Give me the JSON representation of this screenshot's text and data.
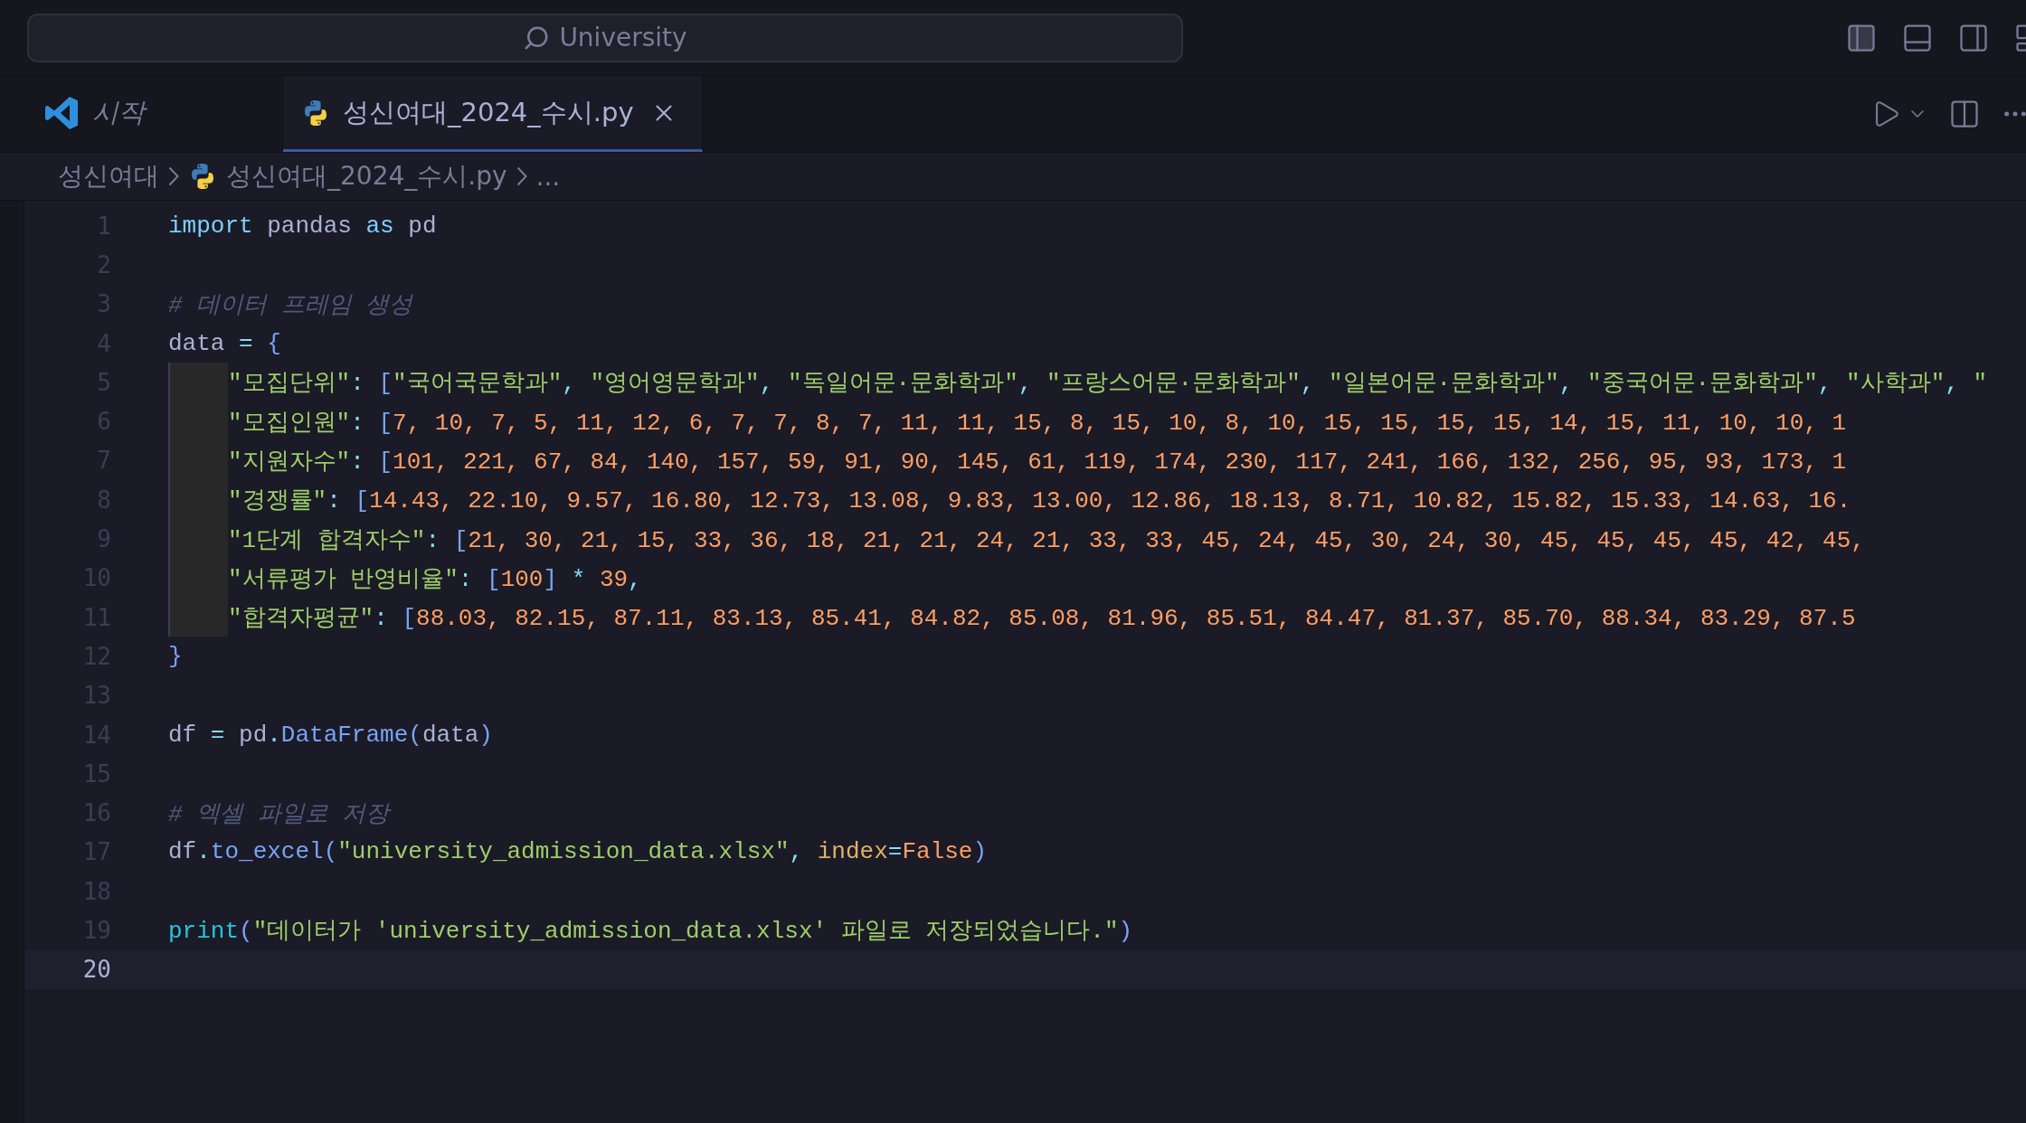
{
  "title_bar": {
    "search": {
      "value": "University"
    }
  },
  "tabs": [
    {
      "label": "시작",
      "kind": "welcome",
      "selected": false,
      "preview": true,
      "closable": false
    },
    {
      "label": "성신여대_2024_수시.py",
      "kind": "python",
      "selected": true,
      "preview": false,
      "closable": true
    }
  ],
  "breadcrumb": [
    {
      "label": "성신여대",
      "kind": "folder"
    },
    {
      "label": "성신여대_2024_수시.py",
      "kind": "python"
    },
    {
      "label": "...",
      "kind": "more"
    }
  ],
  "editor": {
    "lines": [
      {
        "number": "1",
        "active": false,
        "indented": false,
        "tokens": [
          {
            "kind": "keyword",
            "text": "import"
          },
          {
            "kind": "name",
            "text": " pandas "
          },
          {
            "kind": "keyword",
            "text": "as"
          },
          {
            "kind": "name",
            "text": " pd"
          }
        ]
      },
      {
        "number": "2",
        "active": false,
        "indented": false
      },
      {
        "number": "3",
        "active": false,
        "indented": false,
        "tokens": [
          {
            "kind": "comment",
            "text": "# 데이터 프레임 생성"
          }
        ]
      },
      {
        "number": "4",
        "active": false,
        "indented": false,
        "tokens": [
          {
            "kind": "name",
            "text": "data "
          },
          {
            "kind": "operator",
            "text": "="
          },
          {
            "kind": "bracket",
            "text": " {"
          }
        ]
      },
      {
        "number": "5",
        "active": false,
        "indented": true,
        "tokens": [
          {
            "kind": "string",
            "text": "\"모집단위\""
          },
          {
            "kind": "operator",
            "text": ": "
          },
          {
            "kind": "bracket",
            "text": "["
          },
          {
            "kind": "string",
            "text": "\"국어국문학과\""
          },
          {
            "kind": "operator",
            "text": ", "
          },
          {
            "kind": "string",
            "text": "\"영어영문학과\""
          },
          {
            "kind": "operator",
            "text": ", "
          },
          {
            "kind": "string",
            "text": "\"독일어문·문화학과\""
          },
          {
            "kind": "operator",
            "text": ", "
          },
          {
            "kind": "string",
            "text": "\"프랑스어문·문화학과\""
          },
          {
            "kind": "operator",
            "text": ", "
          },
          {
            "kind": "string",
            "text": "\"일본어문·문화학과\""
          },
          {
            "kind": "operator",
            "text": ", "
          },
          {
            "kind": "string",
            "text": "\"중국어문·문화학과\""
          },
          {
            "kind": "operator",
            "text": ", "
          },
          {
            "kind": "string",
            "text": "\"사학과\""
          },
          {
            "kind": "operator",
            "text": ", "
          },
          {
            "kind": "string",
            "text": "\""
          }
        ]
      },
      {
        "number": "6",
        "active": false,
        "indented": true,
        "tokens": [
          {
            "kind": "string",
            "text": "\"모집인원\""
          },
          {
            "kind": "operator",
            "text": ": "
          },
          {
            "kind": "bracket",
            "text": "["
          },
          {
            "kind": "number",
            "text": "7, 10, 7, 5, 11, 12, 6, 7, 7, 8, 7, 11, 11, 15, 8, 15, 10, 8, 10, 15, 15, 15, 15, 14, 15, 11, 10, 10, 1"
          }
        ]
      },
      {
        "number": "7",
        "active": false,
        "indented": true,
        "tokens": [
          {
            "kind": "string",
            "text": "\"지원자수\""
          },
          {
            "kind": "operator",
            "text": ": "
          },
          {
            "kind": "bracket",
            "text": "["
          },
          {
            "kind": "number",
            "text": "101, 221, 67, 84, 140, 157, 59, 91, 90, 145, 61, 119, 174, 230, 117, 241, 166, 132, 256, 95, 93, 173, 1"
          }
        ]
      },
      {
        "number": "8",
        "active": false,
        "indented": true,
        "tokens": [
          {
            "kind": "string",
            "text": "\"경쟁률\""
          },
          {
            "kind": "operator",
            "text": ": "
          },
          {
            "kind": "bracket",
            "text": "["
          },
          {
            "kind": "number",
            "text": "14.43, 22.10, 9.57, 16.80, 12.73, 13.08, 9.83, 13.00, 12.86, 18.13, 8.71, 10.82, 15.82, 15.33, 14.63, 16."
          }
        ]
      },
      {
        "number": "9",
        "active": false,
        "indented": true,
        "tokens": [
          {
            "kind": "string",
            "text": "\"1단계 합격자수\""
          },
          {
            "kind": "operator",
            "text": ": "
          },
          {
            "kind": "bracket",
            "text": "["
          },
          {
            "kind": "number",
            "text": "21, 30, 21, 15, 33, 36, 18, 21, 21, 24, 21, 33, 33, 45, 24, 45, 30, 24, 30, 45, 45, 45, 45, 42, 45,"
          }
        ]
      },
      {
        "number": "10",
        "active": false,
        "indented": true,
        "tokens": [
          {
            "kind": "string",
            "text": "\"서류평가 반영비율\""
          },
          {
            "kind": "operator",
            "text": ": "
          },
          {
            "kind": "bracket",
            "text": "["
          },
          {
            "kind": "number",
            "text": "100"
          },
          {
            "kind": "bracket",
            "text": "]"
          },
          {
            "kind": "operator",
            "text": " * "
          },
          {
            "kind": "number",
            "text": "39"
          },
          {
            "kind": "operator",
            "text": ","
          }
        ]
      },
      {
        "number": "11",
        "active": false,
        "indented": true,
        "tokens": [
          {
            "kind": "string",
            "text": "\"합격자평균\""
          },
          {
            "kind": "operator",
            "text": ": "
          },
          {
            "kind": "bracket",
            "text": "["
          },
          {
            "kind": "number",
            "text": "88.03, 82.15, 87.11, 83.13, 85.41, 84.82, 85.08, 81.96, 85.51, 84.47, 81.37, 85.70, 88.34, 83.29, 87.5"
          }
        ]
      },
      {
        "number": "12",
        "active": false,
        "indented": false,
        "tokens": [
          {
            "kind": "bracket",
            "text": "}"
          }
        ]
      },
      {
        "number": "13",
        "active": false,
        "indented": false
      },
      {
        "number": "14",
        "active": false,
        "indented": false,
        "tokens": [
          {
            "kind": "name",
            "text": "df "
          },
          {
            "kind": "operator",
            "text": "="
          },
          {
            "kind": "name",
            "text": " pd"
          },
          {
            "kind": "operator",
            "text": "."
          },
          {
            "kind": "function",
            "text": "DataFrame"
          },
          {
            "kind": "bracket",
            "text": "("
          },
          {
            "kind": "name",
            "text": "data"
          },
          {
            "kind": "bracket",
            "text": ")"
          }
        ]
      },
      {
        "number": "15",
        "active": false,
        "indented": false
      },
      {
        "number": "16",
        "active": false,
        "indented": false,
        "tokens": [
          {
            "kind": "comment",
            "text": "# 엑셀 파일로 저장"
          }
        ]
      },
      {
        "number": "17",
        "active": false,
        "indented": false,
        "tokens": [
          {
            "kind": "name",
            "text": "df"
          },
          {
            "kind": "operator",
            "text": "."
          },
          {
            "kind": "function",
            "text": "to_excel"
          },
          {
            "kind": "bracket",
            "text": "("
          },
          {
            "kind": "string",
            "text": "\"university_admission_data.xlsx\""
          },
          {
            "kind": "operator",
            "text": ", "
          },
          {
            "kind": "parameter",
            "text": "index"
          },
          {
            "kind": "operator",
            "text": "="
          },
          {
            "kind": "number",
            "text": "False"
          },
          {
            "kind": "bracket",
            "text": ")"
          }
        ]
      },
      {
        "number": "18",
        "active": false,
        "indented": false
      },
      {
        "number": "19",
        "active": false,
        "indented": false,
        "tokens": [
          {
            "kind": "builtin",
            "text": "print"
          },
          {
            "kind": "bracket",
            "text": "("
          },
          {
            "kind": "string",
            "text": "\"데이터가 'university_admission_data.xlsx' 파일로 저장되었습니다.\""
          },
          {
            "kind": "bracket",
            "text": ")"
          }
        ]
      },
      {
        "number": "20",
        "active": true,
        "indented": false
      }
    ]
  }
}
